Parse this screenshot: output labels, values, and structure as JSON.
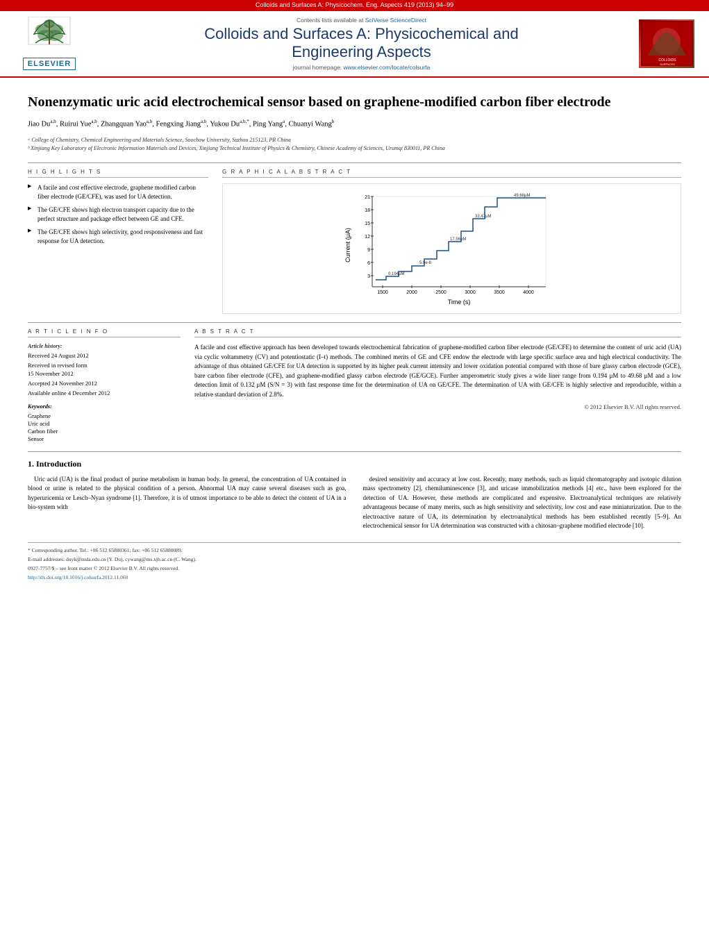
{
  "top_bar": {
    "text": "Colloids and Surfaces A: Physicochem. Eng. Aspects 419 (2013) 94–99"
  },
  "journal_header": {
    "contents_line": "Contents lists available at SciVerse ScienceDirect",
    "journal_title": "Colloids and Surfaces A: Physicochemical and\nEngineering Aspects",
    "homepage_line": "journal homepage: www.elsevier.com/locate/colsurfa",
    "elsevier_label": "ELSEVIER"
  },
  "article": {
    "title": "Nonenzymatic uric acid electrochemical sensor based on graphene-modified carbon fiber electrode",
    "authors": "Jiao Duᵃᵇ, Ruirui Yueᵃᵇ, Zhangquan Yaoᵃᵇ, Fengxing Jiangᵃᵇ, Yukou Duᵃᵇ*, Ping Yangᵃ, Chuanyi Wangᵇ",
    "affiliations_a": "ᵃ College of Chemistry, Chemical Engineering and Materials Science, Soochow University, Suzhou 215123, PR China",
    "affiliations_b": "ᵇ Xinjiang Key Laboratory of Electronic Information Materials and Devices, Xinjiang Technical Institute of Physics & Chemistry, Chinese Academy of Sciences, Urumqi 830011, PR China"
  },
  "highlights": {
    "heading": "H I G H L I G H T S",
    "items": [
      "A facile and cost effective electrode, graphene modified carbon fiber electrode (GE/CFE), was used for UA detection.",
      "The GE/CFE shows high electron transport capacity due to the perfect structure and package effect between GE and CFE.",
      "The GE/CFE shows high selectivity, good responsiveness and fast response for UA detection."
    ]
  },
  "graphical_abstract": {
    "heading": "G R A P H I C A L   A B S T R A C T",
    "x_label": "Time (s)",
    "y_label": "Current (μA)",
    "y_max": "21",
    "y_values": [
      "21",
      "18",
      "15",
      "12",
      "9",
      "6",
      "3"
    ],
    "x_values": [
      "1500",
      "2000",
      "2500",
      "3000",
      "3500",
      "4000"
    ],
    "annotations": [
      "49.68μM",
      "33.47μM",
      "17.5 6μM",
      "5.0e-8",
      "0.194μM"
    ]
  },
  "article_info": {
    "heading": "A R T I C L E   I N F O",
    "history_label": "Article history:",
    "received": "Received 24 August 2012",
    "received_revised": "Received in revised form\n15 November 2012",
    "accepted": "Accepted 24 November 2012",
    "available": "Available online 4 December 2012",
    "keywords_label": "Keywords:",
    "keywords": [
      "Graphene",
      "Uric acid",
      "Carbon fiber",
      "Sensor"
    ]
  },
  "abstract": {
    "heading": "A B S T R A C T",
    "text": "A facile and cost effective approach has been developed towards electrochemical fabrication of graphene-modified carbon fiber electrode (GE/CFE) to determine the content of uric acid (UA) via cyclic voltammetry (CV) and potentiostatic (I–t) methods. The combined merits of GE and CFE endow the electrode with large specific surface area and high electrical conductivity. The advantage of thus obtained GE/CFE for UA detection is supported by its higher peak current intensity and lower oxidation potential compared with those of bare glassy carbon electrode (GCE), bare carbon fiber electrode (CFE), and graphene-modified glassy carbon electrode (GE/GCE). Further amperometric study gives a wide liner range from 0.194 μM to 49.68 μM and a low detection limit of 0.132 μM (S/N = 3) with fast response time for the determination of UA on GE/CFE. The determination of UA with GE/CFE is highly selective and reproducible, within a relative standard deviation of 2.8%.",
    "copyright": "© 2012 Elsevier B.V. All rights reserved."
  },
  "introduction": {
    "section_number": "1.",
    "section_title": "Introduction",
    "paragraph1": "Uric acid (UA) is the final product of purine metabolism in human body. In general, the concentration of UA contained in blood or urine is related to the physical condition of a person. Abnormal UA may cause several diseases such as goa, hyperuricemia or Lesch–Nyan syndrome [1]. Therefore, it is of utmost importance to be able to detect the content of UA in a bio-system with",
    "paragraph2": "desired sensitivity and accuracy at low cost. Recently, many methods, such as liquid chromatography and isotopic dilution mass spectrometry [2], chemiluminescence [3], and uricase immobilization methods [4] etc., have been explored for the detection of UA. However, these methods are complicated and expensive. Electroanalytical techniques are relatively advantageous because of many merits, such as high sensitivity and selectivity, low cost and ease miniaturization. Due to the electroactive nature of UA, its determination by electroanalytical methods has been established recently [5–9]. An electrochemical sensor for UA determination was constructed with a chitosan–graphene modified electrode [10]."
  },
  "footer": {
    "corresponding_author": "* Corresponding author. Tel.: +86 512 65880361; fax: +86 512 65880089.",
    "email_line": "E-mail addresses: duyk@suda.edu.cn (Y. Du), cywang@ms.xjb.ac.cn (C. Wang).",
    "issn": "0927-7757/$ – see front matter © 2012 Elsevier B.V. All rights reserved.",
    "doi": "http://dx.doi.org/10.1016/j.colsurfa.2012.11.060"
  }
}
